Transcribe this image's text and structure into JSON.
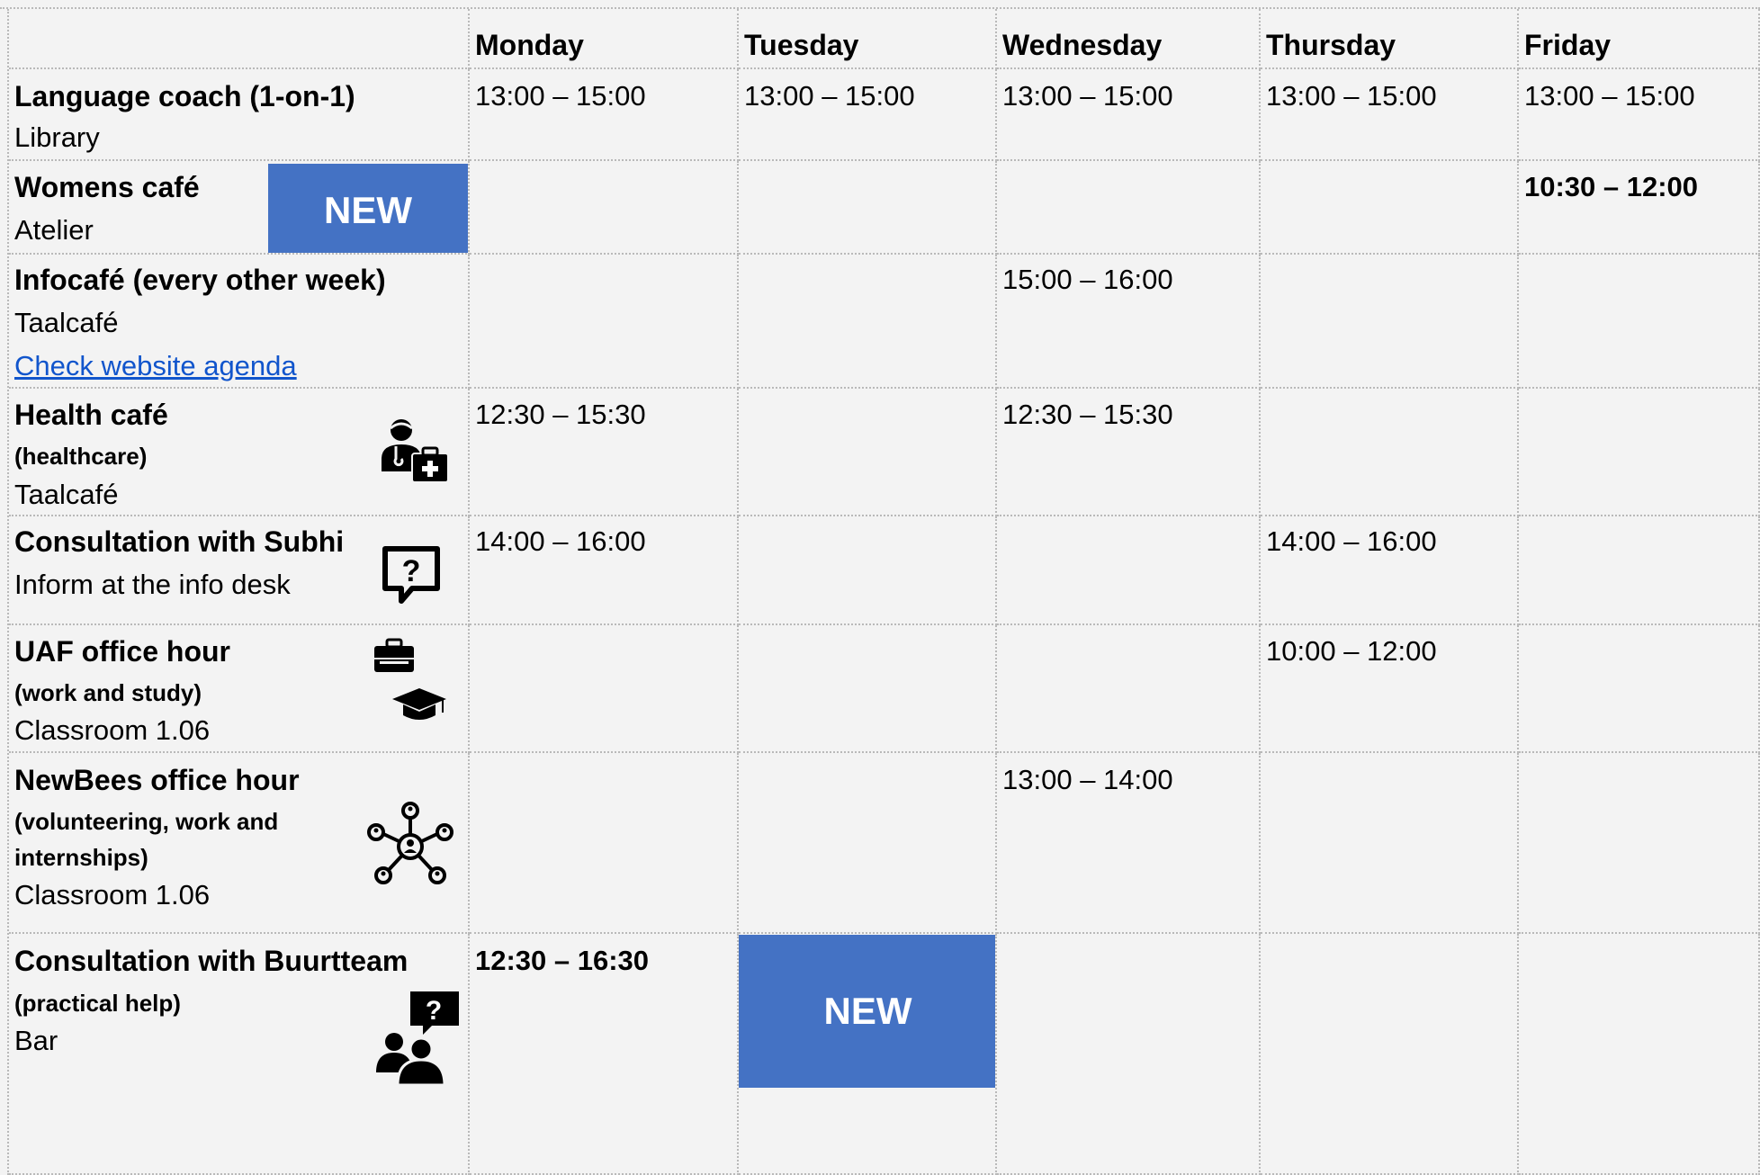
{
  "days": [
    "Monday",
    "Tuesday",
    "Wednesday",
    "Thursday",
    "Friday"
  ],
  "activities": [
    {
      "title": "Language coach (1-on-1)",
      "location": "Library",
      "times": [
        "13:00 – 15:00",
        "13:00 – 15:00",
        "13:00 – 15:00",
        "13:00 – 15:00",
        "13:00 – 15:00"
      ]
    },
    {
      "title": "Womens café",
      "location": "Atelier",
      "badge": "NEW",
      "times": [
        "",
        "",
        "",
        "",
        "10:30 – 12:00"
      ]
    },
    {
      "title": "Infocafé (every other week)",
      "location": "Taalcafé",
      "link": "Check website agenda",
      "times": [
        "",
        "",
        "15:00 – 16:00",
        "",
        ""
      ]
    },
    {
      "title": "Health café",
      "subtitle": "(healthcare)",
      "location": "Taalcafé",
      "icon": "doctor-medical-bag-icon",
      "times": [
        "12:30 – 15:30",
        "",
        "12:30 – 15:30",
        "",
        ""
      ]
    },
    {
      "title": "Consultation with Subhi",
      "location": "Inform at the info desk",
      "icon": "question-speech-bubble-icon",
      "times": [
        "14:00 – 16:00",
        "",
        "",
        "14:00 – 16:00",
        ""
      ]
    },
    {
      "title": "UAF office hour",
      "subtitle": "(work and study)",
      "location": "Classroom 1.06",
      "icon": "briefcase-and-graduation-cap-icon",
      "times": [
        "",
        "",
        "",
        "10:00 – 12:00",
        ""
      ]
    },
    {
      "title": "NewBees office hour",
      "subtitle_lines": [
        "(volunteering, work and",
        "internships)"
      ],
      "location": "Classroom 1.06",
      "icon": "people-network-icon",
      "times": [
        "",
        "",
        "13:00 – 14:00",
        "",
        ""
      ]
    },
    {
      "title": "Consultation with Buurtteam",
      "subtitle": "(practical help)",
      "location": "Bar",
      "icon": "people-question-icon",
      "badge": "NEW",
      "times": [
        "12:30 – 16:30",
        "",
        "",
        "",
        ""
      ]
    }
  ],
  "colors": {
    "badge_bg": "#4472c4",
    "link": "#1155cc",
    "background": "#f3f3f3",
    "grid_line": "#b9b9b9"
  }
}
